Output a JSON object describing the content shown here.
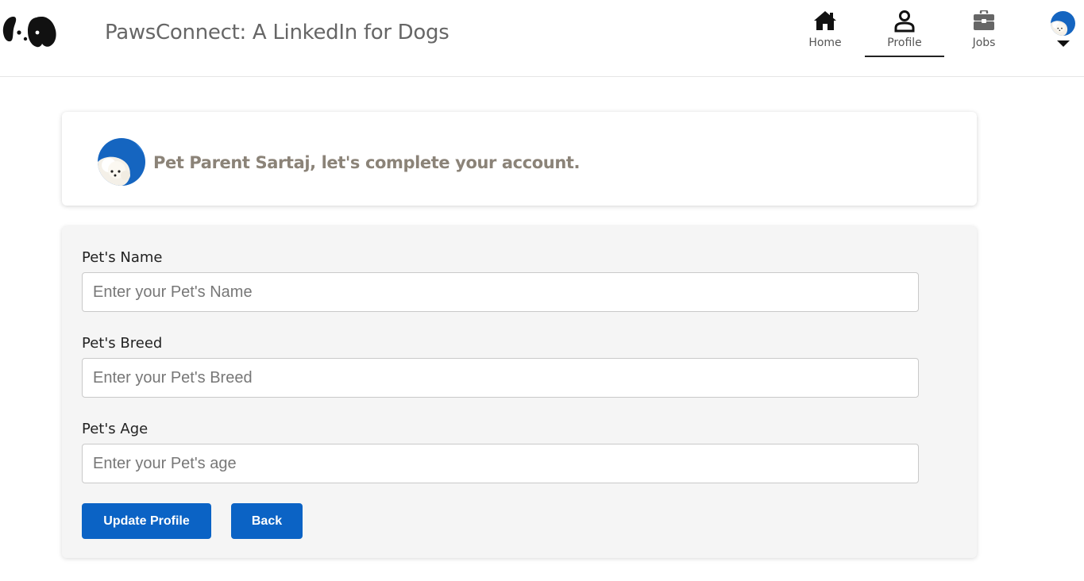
{
  "header": {
    "title": "PawsConnect: A LinkedIn for Dogs",
    "logo_icon": "dog-paw-logo-icon",
    "nav": [
      {
        "label": "Home",
        "icon": "home-icon"
      },
      {
        "label": "Profile",
        "icon": "person-icon",
        "active": true
      },
      {
        "label": "Jobs",
        "icon": "briefcase-icon"
      }
    ],
    "me_icon": "caret-down-icon"
  },
  "welcome": {
    "message": "Pet Parent Sartaj, let's complete your account."
  },
  "form": {
    "name_label": "Pet's Name",
    "name_placeholder": "Enter your Pet's Name",
    "breed_label": "Pet's Breed",
    "breed_placeholder": "Enter your Pet's Breed",
    "age_label": "Pet's Age",
    "age_placeholder": "Enter your Pet's age",
    "update_label": "Update Profile",
    "back_label": "Back"
  },
  "colors": {
    "primary": "#0b63c5",
    "welcome_text": "#8b8378",
    "avatar_bg": "#1565c0"
  }
}
